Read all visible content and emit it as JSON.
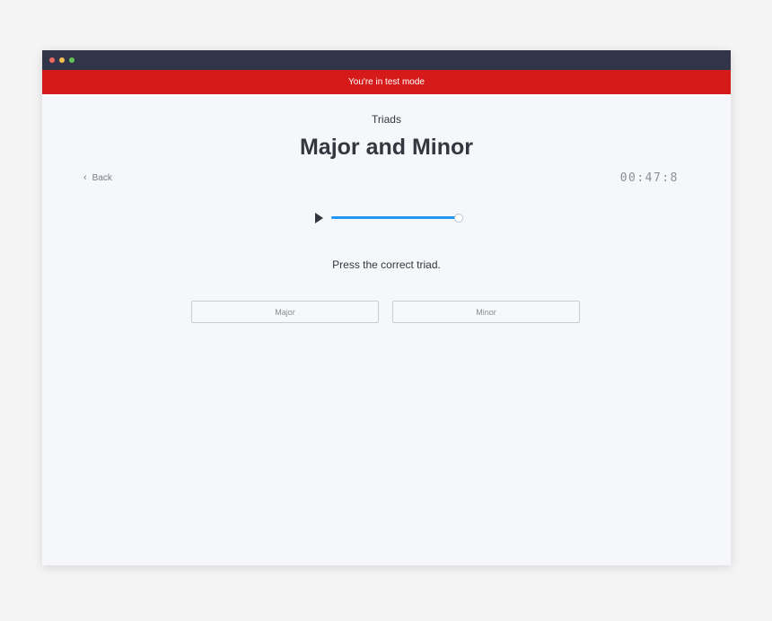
{
  "banner": {
    "text": "You're in test mode"
  },
  "header": {
    "section": "Triads",
    "title": "Major and Minor"
  },
  "nav": {
    "back_label": "Back"
  },
  "timer": {
    "value": "00:47:8"
  },
  "player": {
    "progress": 1.0
  },
  "question": {
    "prompt": "Press the correct triad."
  },
  "answers": [
    {
      "label": "Major"
    },
    {
      "label": "Minor"
    }
  ],
  "colors": {
    "banner": "#d61a1a",
    "titlebar": "#323549",
    "accent": "#2196f3",
    "background": "#f5f7fa"
  }
}
